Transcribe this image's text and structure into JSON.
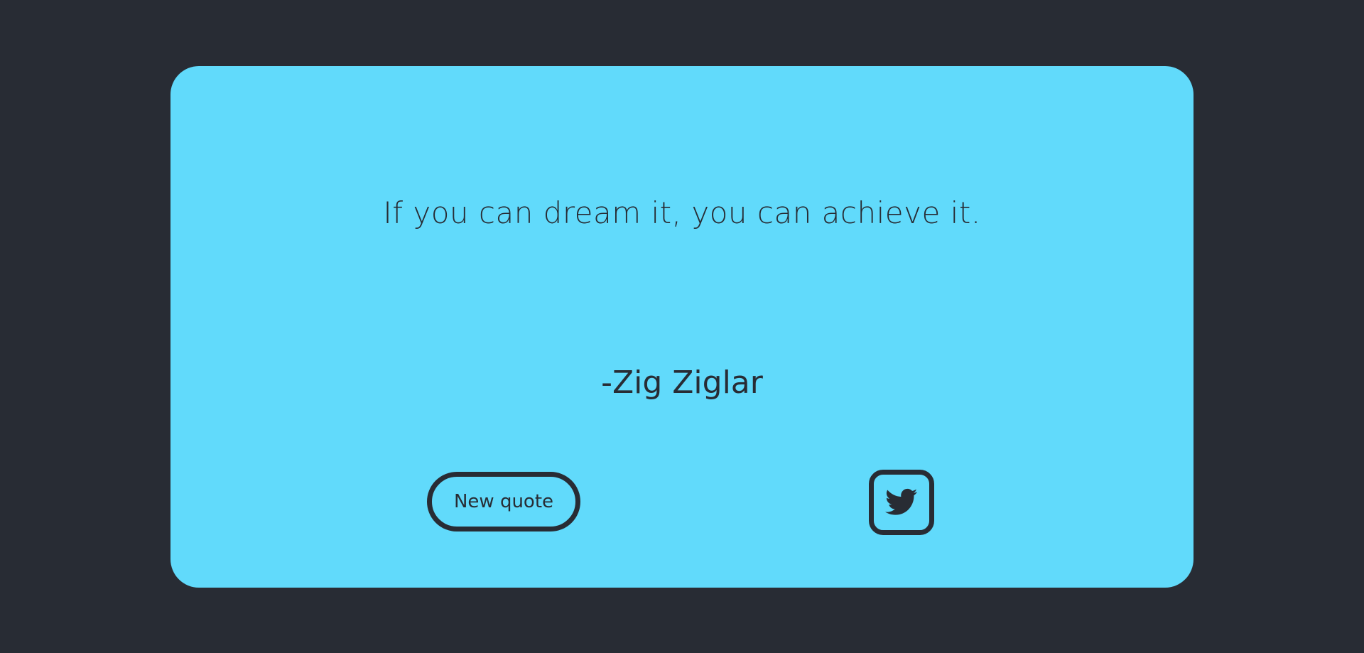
{
  "colors": {
    "background": "#282c34",
    "card": "#61dafb",
    "ink": "#282c34"
  },
  "quote": {
    "text": "If you can dream it, you can achieve it.",
    "author": "-Zig Ziglar"
  },
  "actions": {
    "new_quote_label": "New quote",
    "tweet_icon": "twitter-bird-icon"
  }
}
